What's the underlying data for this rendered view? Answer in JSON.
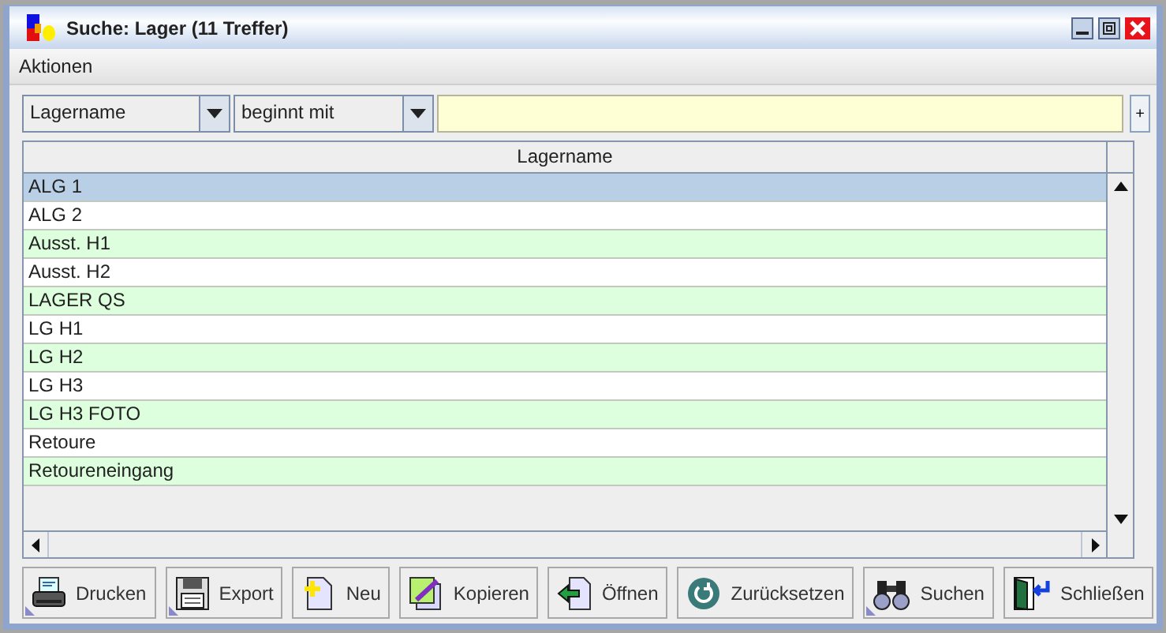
{
  "window": {
    "title": "Suche: Lager (11 Treffer)"
  },
  "menu": [
    "Aktionen"
  ],
  "filter": {
    "field": "Lagername",
    "operator": "beginnt mit",
    "add_button": "+"
  },
  "table": {
    "columns": [
      "Lagername"
    ],
    "rows": [
      {
        "name": "ALG 1",
        "selected": true
      },
      {
        "name": "ALG 2",
        "selected": false
      },
      {
        "name": "Ausst. H1",
        "selected": false
      },
      {
        "name": "Ausst. H2",
        "selected": false
      },
      {
        "name": "LAGER QS",
        "selected": false
      },
      {
        "name": "LG H1",
        "selected": false
      },
      {
        "name": "LG H2",
        "selected": false
      },
      {
        "name": "LG H3",
        "selected": false
      },
      {
        "name": "LG H3 FOTO",
        "selected": false
      },
      {
        "name": "Retoure",
        "selected": false
      },
      {
        "name": "Retoureneingang",
        "selected": false
      }
    ]
  },
  "buttons": [
    {
      "label": "Drucken",
      "kind": "print",
      "menu": true
    },
    {
      "label": "Export",
      "kind": "save",
      "menu": true
    },
    {
      "label": "Neu",
      "kind": "new",
      "menu": false
    },
    {
      "label": "Kopieren",
      "kind": "copy",
      "menu": false
    },
    {
      "label": "Öffnen",
      "kind": "open",
      "menu": false
    },
    {
      "label": "Zurücksetzen",
      "kind": "reset",
      "menu": false
    },
    {
      "label": "Suchen",
      "kind": "search",
      "menu": true
    },
    {
      "label": "Schließen",
      "kind": "close",
      "menu": false
    }
  ]
}
